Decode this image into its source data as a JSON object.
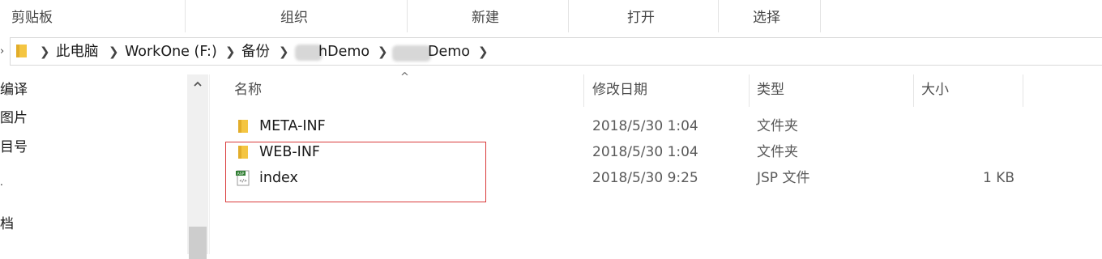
{
  "ribbon": {
    "groups": [
      {
        "label": "剪贴板"
      },
      {
        "label": "组织"
      },
      {
        "label": "新建"
      },
      {
        "label": "打开"
      },
      {
        "label": "选择"
      }
    ]
  },
  "address": {
    "crumbs": [
      {
        "label": "此电脑"
      },
      {
        "label": "WorkOne (F:)"
      },
      {
        "label": "备份"
      },
      {
        "label": "hDemo"
      },
      {
        "label": "Demo"
      }
    ]
  },
  "nav": {
    "items": [
      {
        "label": "编译"
      },
      {
        "label": "图片"
      },
      {
        "label": "目号"
      },
      {
        "label": "."
      },
      {
        "label": "档"
      }
    ]
  },
  "columns": {
    "name": "名称",
    "date": "修改日期",
    "type": "类型",
    "size": "大小"
  },
  "files": [
    {
      "name": "META-INF",
      "date": "2018/5/30 1:04",
      "type": "文件夹",
      "size": "",
      "icon": "folder-icon"
    },
    {
      "name": "WEB-INF",
      "date": "2018/5/30 1:04",
      "type": "文件夹",
      "size": "",
      "icon": "folder-icon"
    },
    {
      "name": "index",
      "date": "2018/5/30 9:25",
      "type": "JSP 文件",
      "size": "1 KB",
      "icon": "jsp-file-icon"
    }
  ],
  "icons": {
    "folder_color": "#f4c542",
    "highlight_color": "#d93a3a"
  }
}
